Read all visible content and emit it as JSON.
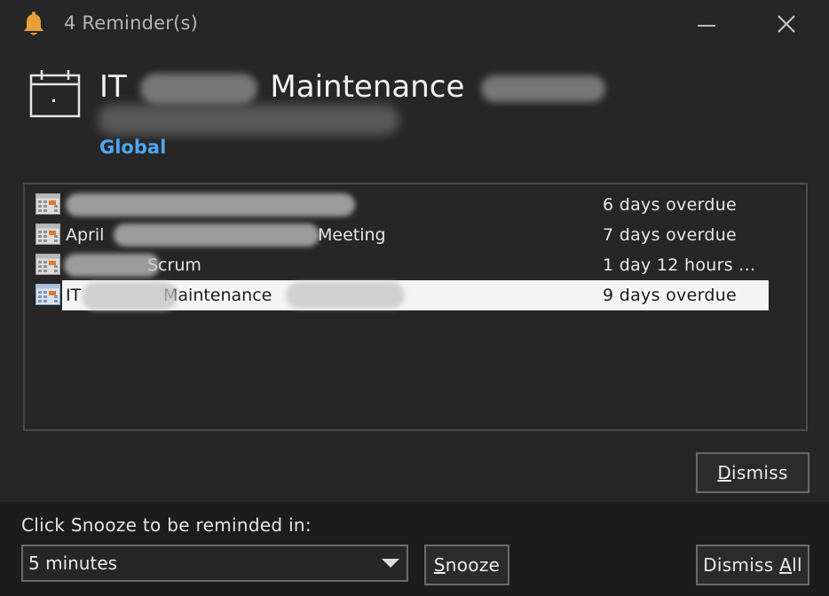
{
  "window": {
    "title": "4 Reminder(s)",
    "icons": {
      "title": "bell-icon",
      "minimize": "minimize-icon",
      "close": "close-icon"
    }
  },
  "header": {
    "subject_prefix": "IT",
    "subject_suffix": "Maintenance",
    "location": "Global",
    "location_color": "#4ea6f0"
  },
  "reminders": [
    {
      "subject": "",
      "due": "6 days overdue",
      "selected": false
    },
    {
      "subject_prefix": "April",
      "subject_suffix": "Meeting",
      "due": "7 days overdue",
      "selected": false
    },
    {
      "subject_suffix": "Scrum",
      "due": "1 day 12 hours ...",
      "selected": false
    },
    {
      "subject_prefix": "IT",
      "subject_suffix": "Maintenance",
      "due": "9 days overdue",
      "selected": true
    }
  ],
  "buttons": {
    "dismiss_mnemonic": "D",
    "dismiss_rest": "ismiss",
    "snooze_mnemonic": "S",
    "snooze_rest": "nooze",
    "dismiss_all_pre": "Dismiss ",
    "dismiss_all_mnemonic": "A",
    "dismiss_all_rest": "ll"
  },
  "snooze": {
    "prompt": "Click Snooze to be reminded in:",
    "selected": "5 minutes"
  },
  "colors": {
    "background": "#262626",
    "bottom_panel": "#1c1c1c",
    "selection": "#f5f5f5",
    "bell": "#e8a13a"
  }
}
